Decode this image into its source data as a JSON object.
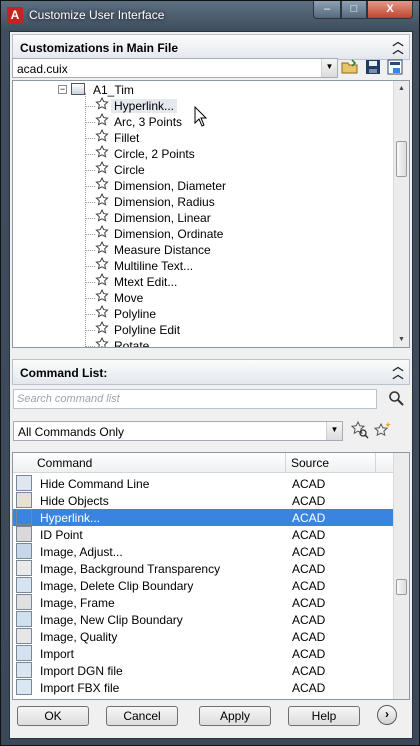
{
  "window": {
    "title": "Customize User Interface",
    "controls": {
      "minimize": "–",
      "maximize": "□",
      "close": "X"
    }
  },
  "customizations": {
    "header": "Customizations in Main File",
    "file": "acad.cuix",
    "tree_parent": "A1_Tim",
    "items": [
      "Hyperlink...",
      "Arc, 3 Points",
      "Fillet",
      "Circle, 2 Points",
      "Circle",
      "Dimension, Diameter",
      "Dimension, Radius",
      "Dimension, Linear",
      "Dimension, Ordinate",
      "Measure Distance",
      "Multiline Text...",
      "Mtext Edit...",
      "Move",
      "Polyline",
      "Polyline Edit",
      "Rotate"
    ],
    "selected_index": 0
  },
  "command_list": {
    "header": "Command List:",
    "search_placeholder": "Search command list",
    "filter": "All Commands Only",
    "columns": {
      "command": "Command",
      "source": "Source"
    },
    "rows": [
      {
        "command": "Hide Command Line",
        "source": "ACAD"
      },
      {
        "command": "Hide Objects",
        "source": "ACAD"
      },
      {
        "command": "Hyperlink...",
        "source": "ACAD",
        "selected": true
      },
      {
        "command": "ID Point",
        "source": "ACAD"
      },
      {
        "command": "Image, Adjust...",
        "source": "ACAD"
      },
      {
        "command": "Image, Background Transparency",
        "source": "ACAD"
      },
      {
        "command": "Image, Delete Clip Boundary",
        "source": "ACAD"
      },
      {
        "command": "Image, Frame",
        "source": "ACAD"
      },
      {
        "command": "Image, New Clip Boundary",
        "source": "ACAD"
      },
      {
        "command": "Image, Quality",
        "source": "ACAD"
      },
      {
        "command": "Import",
        "source": "ACAD"
      },
      {
        "command": "Import DGN file",
        "source": "ACAD"
      },
      {
        "command": "Import FBX file",
        "source": "ACAD"
      }
    ]
  },
  "buttons": {
    "ok": "OK",
    "cancel": "Cancel",
    "apply": "Apply",
    "help": "Help"
  },
  "colors": {
    "selection": "#3a84e0",
    "accent": "#c8221e"
  }
}
